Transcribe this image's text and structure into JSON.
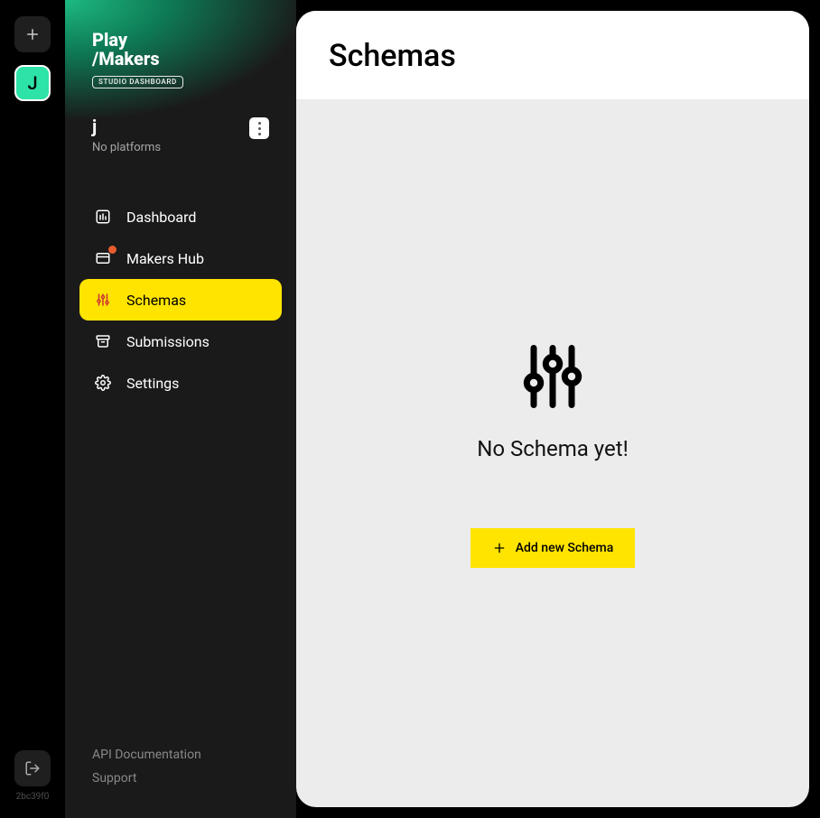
{
  "rail": {
    "avatar_letter": "J",
    "version": "2bc39f0"
  },
  "brand": {
    "line1": "Play",
    "line2": "/Makers",
    "badge": "STUDIO DASHBOARD"
  },
  "workspace": {
    "name": "j",
    "platforms": "No platforms"
  },
  "nav": {
    "items": [
      {
        "label": "Dashboard"
      },
      {
        "label": "Makers Hub"
      },
      {
        "label": "Schemas"
      },
      {
        "label": "Submissions"
      },
      {
        "label": "Settings"
      }
    ]
  },
  "footer": {
    "api": "API Documentation",
    "support": "Support"
  },
  "main": {
    "title": "Schemas",
    "empty_title": "No Schema yet!",
    "add_button": "Add new Schema"
  }
}
